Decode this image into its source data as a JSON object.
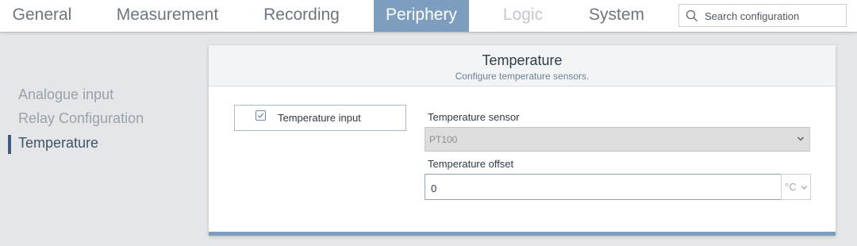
{
  "nav": {
    "tabs": [
      {
        "label": "General",
        "state": "normal"
      },
      {
        "label": "Measurement",
        "state": "normal"
      },
      {
        "label": "Recording",
        "state": "normal"
      },
      {
        "label": "Periphery",
        "state": "active"
      },
      {
        "label": "Logic",
        "state": "disabled"
      },
      {
        "label": "System",
        "state": "normal"
      }
    ],
    "search": {
      "placeholder": "Search configuration",
      "value": "",
      "icon": "search-icon"
    }
  },
  "sidebar": {
    "items": [
      {
        "label": "Analogue input",
        "active": false
      },
      {
        "label": "Relay Configuration",
        "active": false
      },
      {
        "label": "Temperature",
        "active": true
      }
    ]
  },
  "panel": {
    "title": "Temperature",
    "subtitle": "Configure temperature sensors.",
    "toggle": {
      "label": "Temperature input",
      "checked": true,
      "icon": "checkbox-checked-icon"
    },
    "sensor": {
      "label": "Temperature sensor",
      "value": "PT100",
      "icon": "chevron-down-icon"
    },
    "offset": {
      "label": "Temperature offset",
      "value": "0",
      "unit": "°C"
    }
  },
  "colors": {
    "accent": "#7e9ebf",
    "active_indicator": "#3f5a7a",
    "background": "#e4e6e8"
  }
}
